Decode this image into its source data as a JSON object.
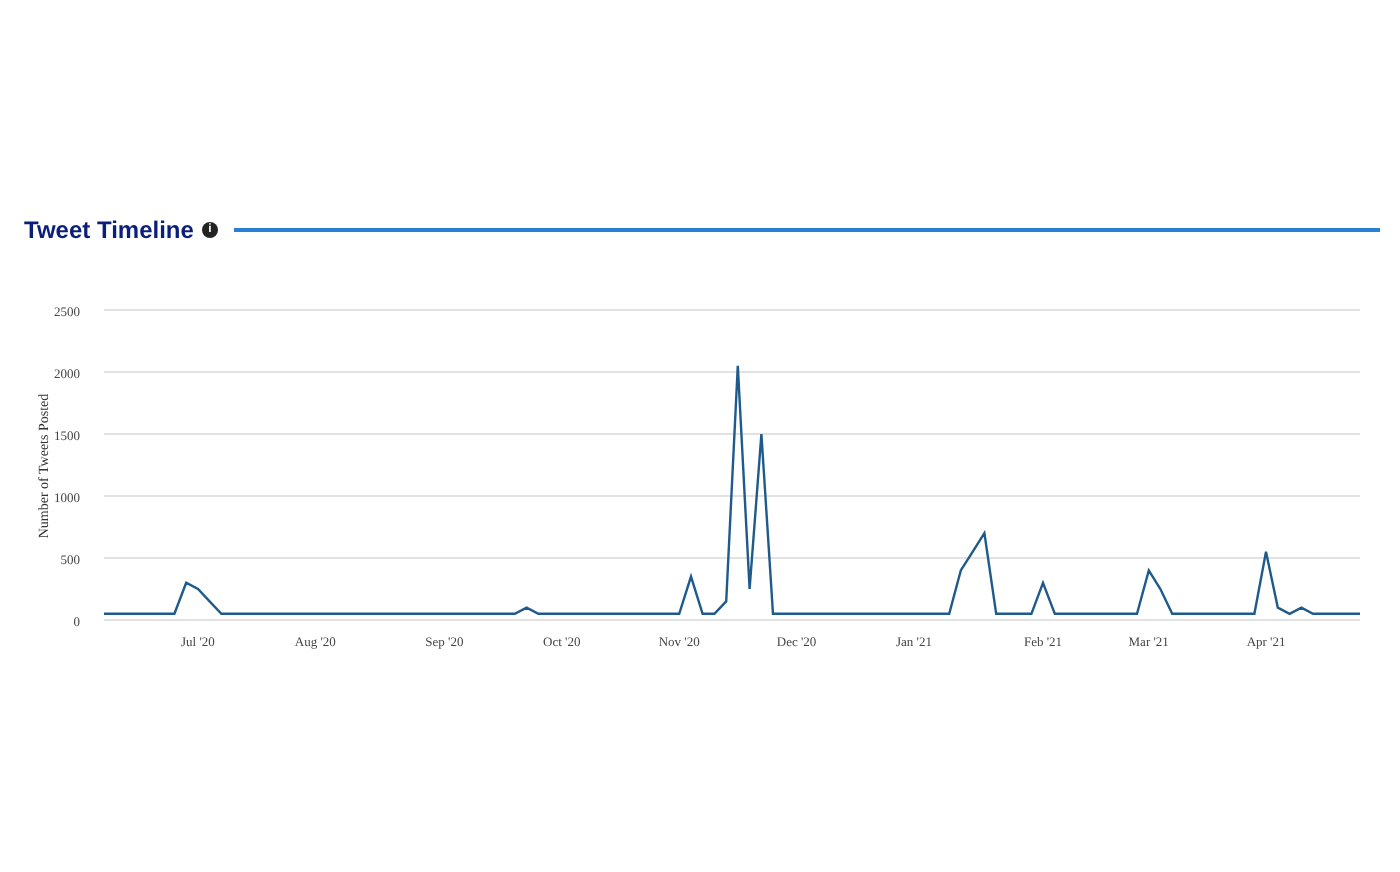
{
  "section": {
    "title": "Tweet Timeline",
    "info_icon": "i"
  },
  "chart": {
    "chart_data": {
      "type": "line",
      "ylabel": "Number of Tweets Posted",
      "categories": [
        null,
        null,
        null,
        null,
        null,
        null,
        null,
        null,
        "Jul '20",
        null,
        null,
        null,
        null,
        null,
        null,
        null,
        null,
        null,
        "Aug '20",
        null,
        null,
        null,
        null,
        null,
        null,
        null,
        null,
        null,
        null,
        "Sep '20",
        null,
        null,
        null,
        null,
        null,
        null,
        null,
        null,
        null,
        "Oct '20",
        null,
        null,
        null,
        null,
        null,
        null,
        null,
        null,
        null,
        "Nov '20",
        null,
        null,
        null,
        null,
        null,
        null,
        null,
        null,
        null,
        "Dec '20",
        null,
        null,
        null,
        null,
        null,
        null,
        null,
        null,
        null,
        "Jan '21",
        null,
        null,
        null,
        null,
        null,
        null,
        null,
        null,
        null,
        null,
        "Feb '21",
        null,
        null,
        null,
        null,
        null,
        null,
        null,
        null,
        "Mar '21",
        null,
        null,
        null,
        null,
        null,
        null,
        null,
        null,
        null,
        "Apr '21",
        null,
        null,
        null,
        null,
        null,
        null,
        null,
        null
      ],
      "series": [
        {
          "color": "#1f5a8c",
          "values": [
            50,
            50,
            50,
            50,
            50,
            50,
            50,
            300,
            250,
            150,
            50,
            50,
            50,
            50,
            50,
            50,
            50,
            50,
            50,
            50,
            50,
            50,
            50,
            50,
            50,
            50,
            50,
            50,
            50,
            50,
            50,
            50,
            50,
            50,
            50,
            50,
            100,
            50,
            50,
            50,
            50,
            50,
            50,
            50,
            50,
            50,
            50,
            50,
            50,
            50,
            350,
            50,
            50,
            150,
            2050,
            250,
            1500,
            50,
            50,
            50,
            50,
            50,
            50,
            50,
            50,
            50,
            50,
            50,
            50,
            50,
            50,
            50,
            50,
            400,
            550,
            700,
            50,
            50,
            50,
            50,
            300,
            50,
            50,
            50,
            50,
            50,
            50,
            50,
            50,
            400,
            250,
            50,
            50,
            50,
            50,
            50,
            50,
            50,
            50,
            550,
            100,
            50,
            100,
            50,
            50,
            50,
            50,
            50
          ]
        }
      ],
      "ylim": [
        0,
        2500
      ],
      "grid": true,
      "yticks": [
        0,
        500,
        1000,
        1500,
        2000,
        2500
      ]
    }
  }
}
